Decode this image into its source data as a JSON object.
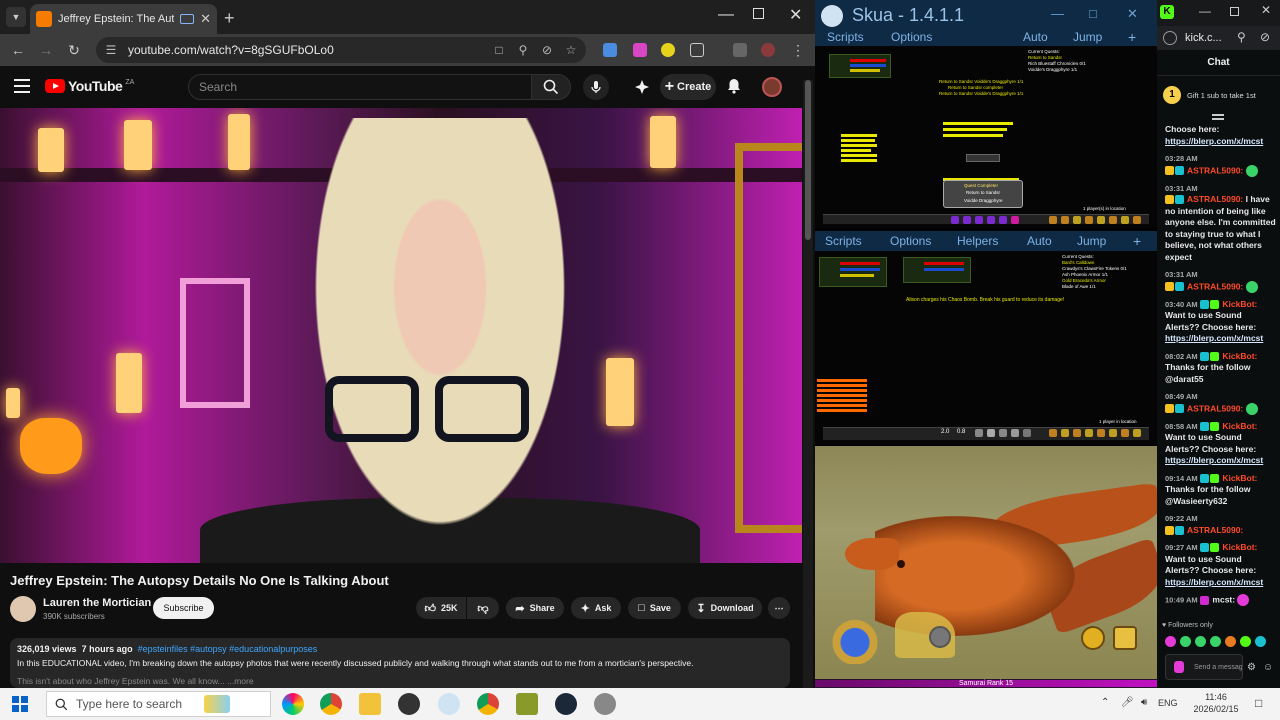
{
  "browser": {
    "tab_title": "Jeffrey Epstein: The Autopsy",
    "url": "youtube.com/watch?v=8gSGUFbOLo0"
  },
  "youtube": {
    "logo_text": "YouTube",
    "logo_country": "ZA",
    "search_placeholder": "Search",
    "create_label": "Create",
    "video_title": "Jeffrey Epstein: The Autopsy Details No One Is Talking About",
    "channel_name": "Lauren the Mortician",
    "channel_subs": "390K subscribers",
    "subscribe_label": "Subscribe",
    "like_count": "25K",
    "share_label": "Share",
    "ask_label": "Ask",
    "save_label": "Save",
    "download_label": "Download",
    "views": "326,019 views",
    "posted": "7 hours ago",
    "tags": "#epsteinfiles #autopsy #educationalpurposes",
    "description": "In this EDUCATIONAL video, I'm breaking down the autopsy photos that were recently discussed publicly and walking through what stands out to me from a mortician's perspective.",
    "description_more": "This isn't about who Jeffrey Epstein was. We all know... ...more"
  },
  "skua": {
    "title": "Skua - 1.4.1.1",
    "menu1": {
      "scripts": "Scripts",
      "options": "Options",
      "auto": "Auto",
      "jump": "Jump",
      "plus": "+"
    },
    "menu2": {
      "scripts": "Scripts",
      "options": "Options",
      "helpers": "Helpers",
      "auto": "Auto",
      "jump": "Jump",
      "plus": "+"
    },
    "panel1_quests_title": "Current Quests:",
    "panel1_quest1": "Return to Sandsr",
    "panel1_quest2": "Rich Bluestaff Chronicles 0/1",
    "panel1_quest3": "Voidde's Draggphyre 1/1",
    "panel1_center1": "Return to Sandsr Voidde's Draggphyre 1/1",
    "panel1_center2": "Return to Sandsr complete!",
    "panel1_center3": "Return to Sandsr Voidde's Draggphyre 1/1",
    "panel1_quest_complete": "Quest Complete!",
    "panel1_quest_complete_name": "Return to Sandsr",
    "panel1_reward": "Voidde Draggphyre",
    "panel1_players": "1 player(s) in location",
    "panel2_quests_title": "Current Quests:",
    "panel2_quest1": "Bard's Calldown",
    "panel2_quest2": "Crawdys's ClawsFire Tokens 0/1",
    "panel2_quest3": "Ash Phoenix Armor 1/1",
    "panel2_quest4": "Gold Braceda's Armor",
    "panel2_quest5": "Blade of Awe 1/1",
    "panel2_center": "Alison charges his Chaos Bomb. Break his guard to reduce its damage!",
    "panel2_players": "1 player in location",
    "panel2_num1": "2.0",
    "panel2_num2": "0.8",
    "rank_label": "Samurai Rank 15",
    "rank_fraction": 1.0
  },
  "kick": {
    "url": "kick.c...",
    "chat_header": "Chat",
    "gift_text": "Gift 1 sub to take 1st",
    "messages": [
      {
        "time": "",
        "user": "",
        "text": "Choose here:",
        "link": "https://blerp.com/x/mcst"
      },
      {
        "time": "03:28 AM",
        "user": "ASTRAL5090:",
        "text": "",
        "link": ""
      },
      {
        "time": "03:31 AM",
        "user": "ASTRAL5090:",
        "text": "I have no intention of being like anyone else. I'm committed to staying true to what I believe, not what others expect",
        "link": ""
      },
      {
        "time": "03:31 AM",
        "user": "ASTRAL5090:",
        "text": "",
        "link": ""
      },
      {
        "time": "03:40 AM",
        "user": "KickBot:",
        "text": "Want to use Sound Alerts?? Choose here:",
        "link": "https://blerp.com/x/mcst"
      },
      {
        "time": "08:02 AM",
        "user": "KickBot:",
        "text": "Thanks for the follow @darat55",
        "link": ""
      },
      {
        "time": "08:49 AM",
        "user": "ASTRAL5090:",
        "text": "",
        "link": ""
      },
      {
        "time": "08:58 AM",
        "user": "KickBot:",
        "text": "Want to use Sound Alerts?? Choose here:",
        "link": "https://blerp.com/x/mcst"
      },
      {
        "time": "09:14 AM",
        "user": "KickBot:",
        "text": "Thanks for the follow @Wasieerty632",
        "link": ""
      },
      {
        "time": "09:22 AM",
        "user": "ASTRAL5090:",
        "text": "",
        "link": ""
      },
      {
        "time": "09:27 AM",
        "user": "KickBot:",
        "text": "Want to use Sound Alerts?? Choose here:",
        "link": "https://blerp.com/x/mcst"
      },
      {
        "time": "10:49 AM",
        "user": "mcst:",
        "text": "",
        "link": ""
      }
    ],
    "followers_only": "Followers only",
    "send_placeholder": "Send a message"
  },
  "taskbar": {
    "search_placeholder": "Type here to search",
    "language": "ENG",
    "time": "11:46",
    "date": "2026/02/15"
  },
  "colors": {
    "youtube_red": "#ff0000",
    "kick_green": "#53fc18",
    "skua_blue": "#0f2a45",
    "link_blue": "#3ea6ff"
  }
}
